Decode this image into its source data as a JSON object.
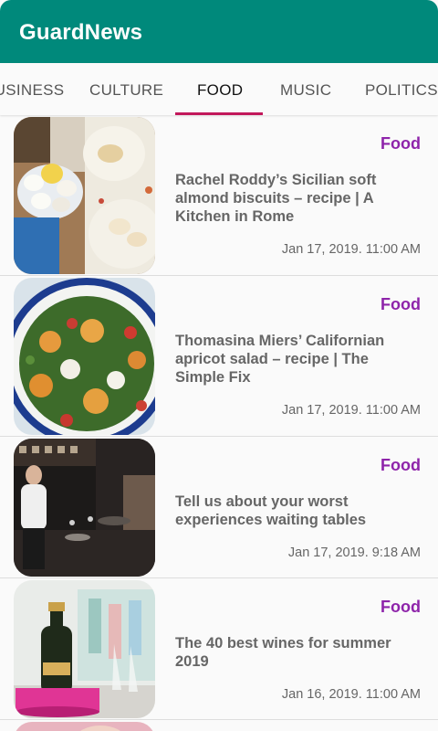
{
  "app": {
    "title": "GuardNews"
  },
  "tabs": [
    {
      "label": "BUSINESS",
      "active": false
    },
    {
      "label": "CULTURE",
      "active": false
    },
    {
      "label": "FOOD",
      "active": true
    },
    {
      "label": "MUSIC",
      "active": false
    },
    {
      "label": "POLITICS",
      "active": false
    }
  ],
  "colors": {
    "appbar": "#00897b",
    "indicator": "#c2185b",
    "category": "#8e24aa"
  },
  "articles": [
    {
      "category": "Food",
      "title": "Rachel Roddy’s Sicilian soft almond biscuits – recipe | A Kitchen in Rome",
      "date": "Jan 17, 2019. 11:00 AM",
      "image": "eggs-and-biscuits-photo"
    },
    {
      "category": "Food",
      "title": "Thomasina Miers’ Californian apricot salad – recipe | The Simple Fix",
      "date": "Jan 17, 2019. 11:00 AM",
      "image": "apricot-salad-photo"
    },
    {
      "category": "Food",
      "title": "Tell us about your worst experiences waiting tables",
      "date": "Jan 17, 2019. 9:18 AM",
      "image": "waiter-restaurant-photo"
    },
    {
      "category": "Food",
      "title": "The 40 best wines for summer 2019",
      "date": "Jan 16, 2019. 11:00 AM",
      "image": "wine-bottle-beach-photo"
    }
  ]
}
